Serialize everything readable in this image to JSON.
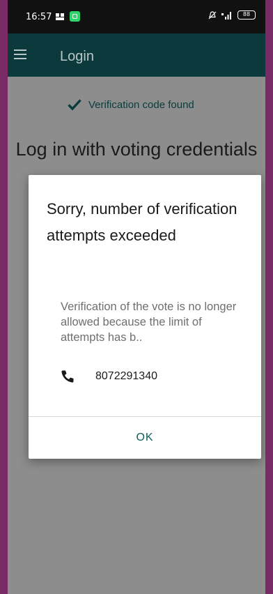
{
  "status_bar": {
    "time": "16:57",
    "battery": "88",
    "icons": [
      "notification-icon",
      "app-icon",
      "mute-icon",
      "signal-icon",
      "battery-icon"
    ]
  },
  "app_bar": {
    "title": "Login",
    "menu_icon": "hamburger-menu-icon",
    "background": "#0c3a3c"
  },
  "page": {
    "verified_text": "Verification code found",
    "verified_icon": "check-icon",
    "heading": "Log in with voting credentials"
  },
  "dialog": {
    "title": "Sorry, number of verification attempts exceeded",
    "body": "Verification of the vote is no longer allowed because the limit of  attempts has b..",
    "phone_icon": "phone-icon",
    "phone_number": "8072291340",
    "ok_label": "OK",
    "accent": "#0e5c5c"
  }
}
